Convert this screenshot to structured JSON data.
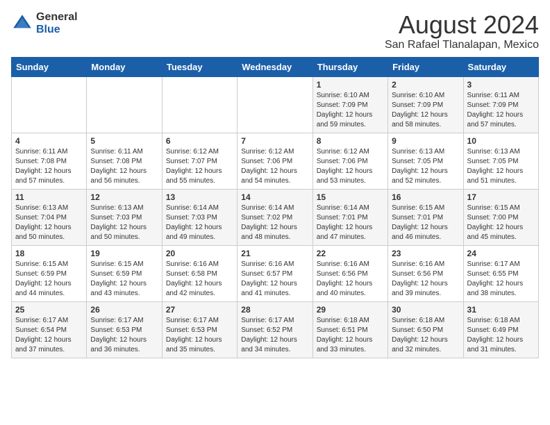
{
  "logo": {
    "general": "General",
    "blue": "Blue"
  },
  "title": "August 2024",
  "subtitle": "San Rafael Tlanalapan, Mexico",
  "days_of_week": [
    "Sunday",
    "Monday",
    "Tuesday",
    "Wednesday",
    "Thursday",
    "Friday",
    "Saturday"
  ],
  "weeks": [
    [
      {
        "day": "",
        "info": ""
      },
      {
        "day": "",
        "info": ""
      },
      {
        "day": "",
        "info": ""
      },
      {
        "day": "",
        "info": ""
      },
      {
        "day": "1",
        "info": "Sunrise: 6:10 AM\nSunset: 7:09 PM\nDaylight: 12 hours and 59 minutes."
      },
      {
        "day": "2",
        "info": "Sunrise: 6:10 AM\nSunset: 7:09 PM\nDaylight: 12 hours and 58 minutes."
      },
      {
        "day": "3",
        "info": "Sunrise: 6:11 AM\nSunset: 7:09 PM\nDaylight: 12 hours and 57 minutes."
      }
    ],
    [
      {
        "day": "4",
        "info": "Sunrise: 6:11 AM\nSunset: 7:08 PM\nDaylight: 12 hours and 57 minutes."
      },
      {
        "day": "5",
        "info": "Sunrise: 6:11 AM\nSunset: 7:08 PM\nDaylight: 12 hours and 56 minutes."
      },
      {
        "day": "6",
        "info": "Sunrise: 6:12 AM\nSunset: 7:07 PM\nDaylight: 12 hours and 55 minutes."
      },
      {
        "day": "7",
        "info": "Sunrise: 6:12 AM\nSunset: 7:06 PM\nDaylight: 12 hours and 54 minutes."
      },
      {
        "day": "8",
        "info": "Sunrise: 6:12 AM\nSunset: 7:06 PM\nDaylight: 12 hours and 53 minutes."
      },
      {
        "day": "9",
        "info": "Sunrise: 6:13 AM\nSunset: 7:05 PM\nDaylight: 12 hours and 52 minutes."
      },
      {
        "day": "10",
        "info": "Sunrise: 6:13 AM\nSunset: 7:05 PM\nDaylight: 12 hours and 51 minutes."
      }
    ],
    [
      {
        "day": "11",
        "info": "Sunrise: 6:13 AM\nSunset: 7:04 PM\nDaylight: 12 hours and 50 minutes."
      },
      {
        "day": "12",
        "info": "Sunrise: 6:13 AM\nSunset: 7:03 PM\nDaylight: 12 hours and 50 minutes."
      },
      {
        "day": "13",
        "info": "Sunrise: 6:14 AM\nSunset: 7:03 PM\nDaylight: 12 hours and 49 minutes."
      },
      {
        "day": "14",
        "info": "Sunrise: 6:14 AM\nSunset: 7:02 PM\nDaylight: 12 hours and 48 minutes."
      },
      {
        "day": "15",
        "info": "Sunrise: 6:14 AM\nSunset: 7:01 PM\nDaylight: 12 hours and 47 minutes."
      },
      {
        "day": "16",
        "info": "Sunrise: 6:15 AM\nSunset: 7:01 PM\nDaylight: 12 hours and 46 minutes."
      },
      {
        "day": "17",
        "info": "Sunrise: 6:15 AM\nSunset: 7:00 PM\nDaylight: 12 hours and 45 minutes."
      }
    ],
    [
      {
        "day": "18",
        "info": "Sunrise: 6:15 AM\nSunset: 6:59 PM\nDaylight: 12 hours and 44 minutes."
      },
      {
        "day": "19",
        "info": "Sunrise: 6:15 AM\nSunset: 6:59 PM\nDaylight: 12 hours and 43 minutes."
      },
      {
        "day": "20",
        "info": "Sunrise: 6:16 AM\nSunset: 6:58 PM\nDaylight: 12 hours and 42 minutes."
      },
      {
        "day": "21",
        "info": "Sunrise: 6:16 AM\nSunset: 6:57 PM\nDaylight: 12 hours and 41 minutes."
      },
      {
        "day": "22",
        "info": "Sunrise: 6:16 AM\nSunset: 6:56 PM\nDaylight: 12 hours and 40 minutes."
      },
      {
        "day": "23",
        "info": "Sunrise: 6:16 AM\nSunset: 6:56 PM\nDaylight: 12 hours and 39 minutes."
      },
      {
        "day": "24",
        "info": "Sunrise: 6:17 AM\nSunset: 6:55 PM\nDaylight: 12 hours and 38 minutes."
      }
    ],
    [
      {
        "day": "25",
        "info": "Sunrise: 6:17 AM\nSunset: 6:54 PM\nDaylight: 12 hours and 37 minutes."
      },
      {
        "day": "26",
        "info": "Sunrise: 6:17 AM\nSunset: 6:53 PM\nDaylight: 12 hours and 36 minutes."
      },
      {
        "day": "27",
        "info": "Sunrise: 6:17 AM\nSunset: 6:53 PM\nDaylight: 12 hours and 35 minutes."
      },
      {
        "day": "28",
        "info": "Sunrise: 6:17 AM\nSunset: 6:52 PM\nDaylight: 12 hours and 34 minutes."
      },
      {
        "day": "29",
        "info": "Sunrise: 6:18 AM\nSunset: 6:51 PM\nDaylight: 12 hours and 33 minutes."
      },
      {
        "day": "30",
        "info": "Sunrise: 6:18 AM\nSunset: 6:50 PM\nDaylight: 12 hours and 32 minutes."
      },
      {
        "day": "31",
        "info": "Sunrise: 6:18 AM\nSunset: 6:49 PM\nDaylight: 12 hours and 31 minutes."
      }
    ]
  ]
}
